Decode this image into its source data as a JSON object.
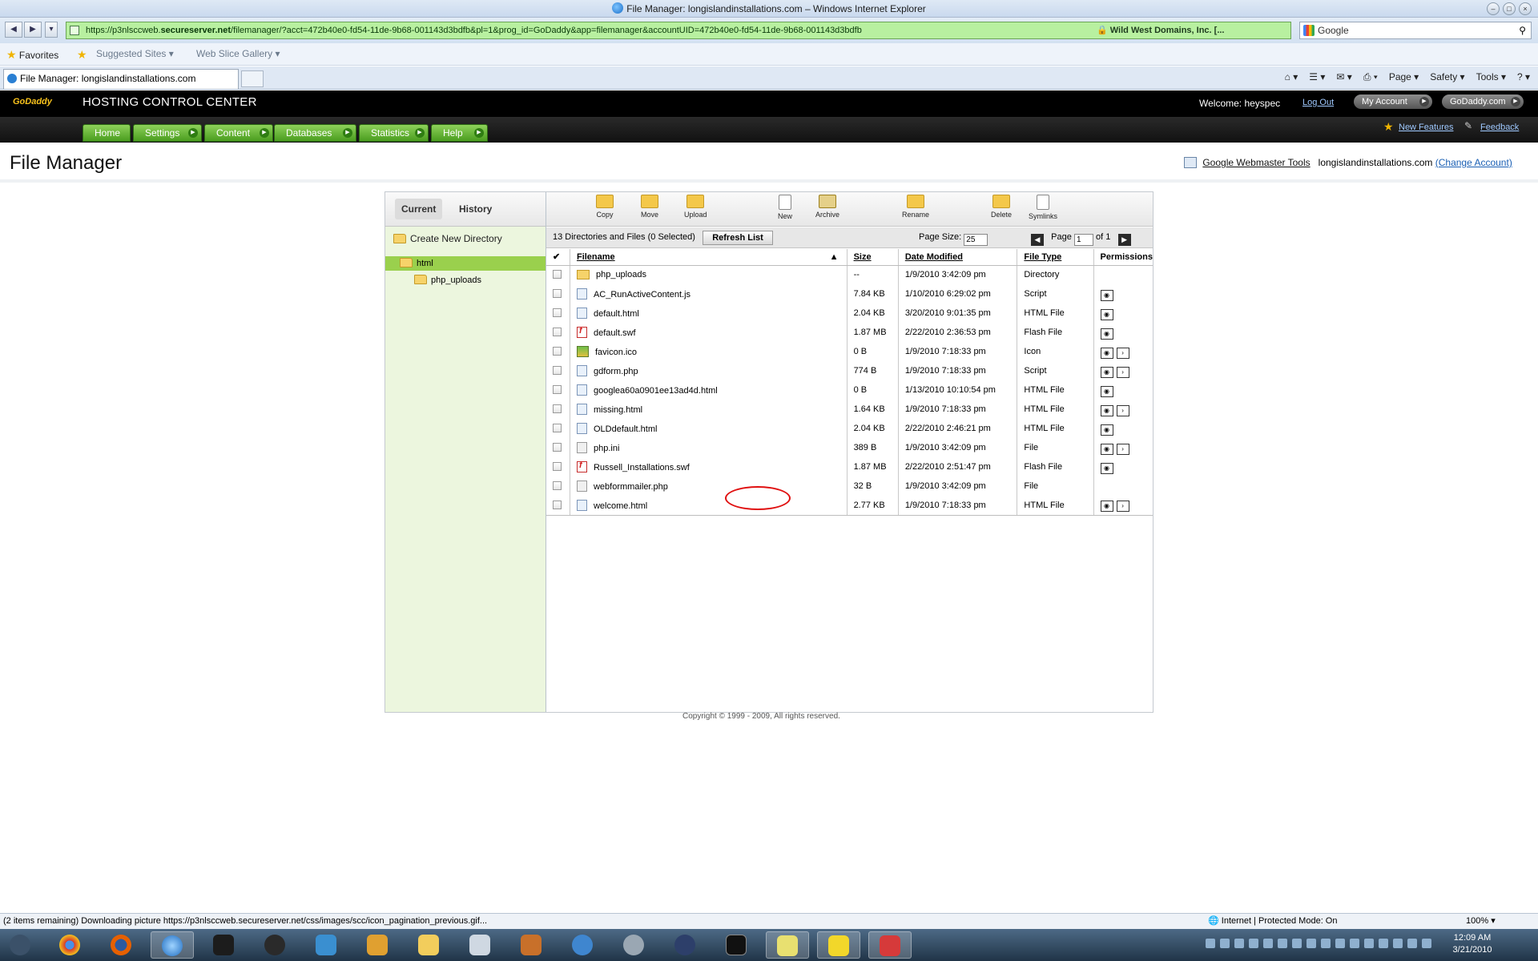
{
  "browser": {
    "window_title": "File Manager: longislandinstallations.com – Windows Internet Explorer",
    "address": {
      "prefix": "https://p3nlsccweb.",
      "host": "secureserver.net",
      "path": "/filemanager/?acct=472b40e0-fd54-11de-9b68-001143d3bdfb&pl=1&prog_id=GoDaddy&app=filemanager&accountUID=472b40e0-fd54-11de-9b68-001143d3bdfb",
      "cert": "Wild West Domains, Inc. [..."
    },
    "search_placeholder": "Google",
    "favorites": {
      "favorites_label": "Favorites",
      "suggested_label": "Suggested Sites ▾",
      "webslice_label": "Web Slice Gallery ▾"
    },
    "tab_title": "File Manager: longislandinstallations.com",
    "command_bar": [
      "Page ▾",
      "Safety ▾",
      "Tools ▾",
      "? ▾"
    ],
    "status_text": "(2 items remaining) Downloading picture https://p3nlsccweb.secureserver.net/css/images/scc/icon_pagination_previous.gif...",
    "zone_text": "Internet | Protected Mode: On",
    "zoom_text": "100% ▾"
  },
  "header": {
    "logo_text": "GoDaddy",
    "product_title": "HOSTING CONTROL CENTER",
    "welcome": "Welcome: heyspec",
    "logout": "Log Out",
    "my_account": "My Account",
    "godaddy_com": "GoDaddy.com",
    "nav": [
      "Home",
      "Settings",
      "Content",
      "Databases",
      "Statistics",
      "Help"
    ],
    "new_features": "New Features",
    "feedback": "Feedback"
  },
  "page": {
    "title": "File Manager",
    "webmaster_tools": "Google Webmaster Tools",
    "domain": "longislandinstallations.com",
    "change_account": "(Change Account)"
  },
  "file_manager": {
    "tabs": {
      "current": "Current",
      "history": "History"
    },
    "create_dir": "Create New Directory",
    "tree": {
      "root": "html",
      "child": "php_uploads"
    },
    "toolbar": [
      "Copy",
      "Move",
      "Upload",
      "New",
      "Archive",
      "Rename",
      "Delete",
      "Symlinks"
    ],
    "info": "13 Directories and Files (0 Selected)",
    "refresh": "Refresh List",
    "page_size_label": "Page Size:",
    "page_size_value": "25",
    "page_label": "Page",
    "page_value": "1",
    "page_of": "of 1",
    "columns": {
      "filename": "Filename",
      "size": "Size",
      "date": "Date Modified",
      "type": "File Type",
      "perms": "Permissions"
    },
    "files": [
      {
        "name": "php_uploads",
        "size": "--",
        "date": "1/9/2010 3:42:09 pm",
        "type": "Directory",
        "icon": "folder-icon",
        "perms": 0
      },
      {
        "name": "AC_RunActiveContent.js",
        "size": "7.84 KB",
        "date": "1/10/2010 6:29:02 pm",
        "type": "Script",
        "icon": "doc-icon",
        "perms": 1
      },
      {
        "name": "default.html",
        "size": "2.04 KB",
        "date": "3/20/2010 9:01:35 pm",
        "type": "HTML File",
        "icon": "doc-icon",
        "perms": 1
      },
      {
        "name": "default.swf",
        "size": "1.87 MB",
        "date": "2/22/2010 2:36:53 pm",
        "type": "Flash File",
        "icon": "flash-icon",
        "perms": 1
      },
      {
        "name": "favicon.ico",
        "size": "0 B",
        "date": "1/9/2010 7:18:33 pm",
        "type": "Icon",
        "icon": "image-icon",
        "perms": 2
      },
      {
        "name": "gdform.php",
        "size": "774 B",
        "date": "1/9/2010 7:18:33 pm",
        "type": "Script",
        "icon": "doc-icon",
        "perms": 2
      },
      {
        "name": "googlea60a0901ee13ad4d.html",
        "size": "0 B",
        "date": "1/13/2010 10:10:54 pm",
        "type": "HTML File",
        "icon": "doc-icon",
        "perms": 1
      },
      {
        "name": "missing.html",
        "size": "1.64 KB",
        "date": "1/9/2010 7:18:33 pm",
        "type": "HTML File",
        "icon": "doc-icon",
        "perms": 2
      },
      {
        "name": "OLDdefault.html",
        "size": "2.04 KB",
        "date": "2/22/2010 2:46:21 pm",
        "type": "HTML File",
        "icon": "doc-icon",
        "perms": 1
      },
      {
        "name": "php.ini",
        "size": "389 B",
        "date": "1/9/2010 3:42:09 pm",
        "type": "File",
        "icon": "generic-file-icon",
        "perms": 2
      },
      {
        "name": "Russell_Installations.swf",
        "size": "1.87 MB",
        "date": "2/22/2010 2:51:47 pm",
        "type": "Flash File",
        "icon": "flash-icon",
        "perms": 1
      },
      {
        "name": "webformmailer.php",
        "size": "32 B",
        "date": "1/9/2010 3:42:09 pm",
        "type": "File",
        "icon": "generic-file-icon",
        "perms": 0
      },
      {
        "name": "welcome.html",
        "size": "2.77 KB",
        "date": "1/9/2010 7:18:33 pm",
        "type": "HTML File",
        "icon": "doc-icon",
        "perms": 2
      }
    ],
    "copyright": "Copyright © 1999 - 2009, All rights reserved."
  },
  "taskbar": {
    "time": "12:09 AM",
    "date": "3/21/2010"
  },
  "colors": {
    "nav_green": "#5aab2a",
    "tree_selected": "#9ad04d",
    "address_secure": "#b8f0a0",
    "annotation_circle": "#e01010"
  }
}
